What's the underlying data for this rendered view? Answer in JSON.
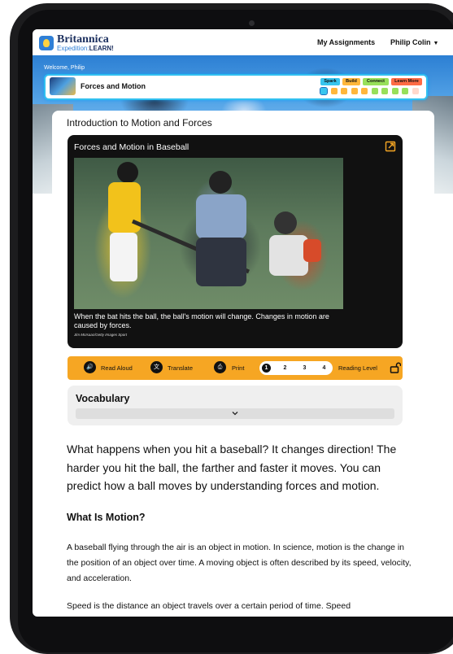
{
  "header": {
    "logo_main": "Britannica",
    "logo_sub_prefix": "Expedition:",
    "logo_sub_brand": "LEARN!",
    "nav_assignments": "My Assignments",
    "user_name": "Philip Colin"
  },
  "lesson": {
    "welcome": "Welcome, Philip",
    "title": "Forces and Motion",
    "phases": [
      "Spark",
      "Build",
      "Connect",
      "Learn More"
    ],
    "progress_colors": [
      "#37c5ee",
      "#ffb73b",
      "#ffb73b",
      "#ffb73b",
      "#ffb73b",
      "#98e05a",
      "#98e05a",
      "#98e05a",
      "#98e05a",
      "#ffd9cc"
    ]
  },
  "page": {
    "title": "Introduction to Motion and Forces"
  },
  "media": {
    "title": "Forces and Motion in Baseball",
    "caption": "When the bat hits the ball, the ball's motion will change. Changes in motion are caused by forces.",
    "credit": "Jim McIsaac/Getty Images Sport"
  },
  "toolbar": {
    "read_aloud": "Read Aloud",
    "translate": "Translate",
    "print": "Print",
    "levels": [
      "1",
      "2",
      "3",
      "4"
    ],
    "active_level": "1",
    "reading_level": "Reading Level"
  },
  "vocab": {
    "title": "Vocabulary"
  },
  "article": {
    "intro": "What happens when you hit a baseball? It changes direction! The harder you hit the ball, the farther and faster it moves. You can predict how a ball moves by understanding forces and motion.",
    "heading": "What Is Motion?",
    "p1": "A baseball flying through the air is an object in motion. In science, motion is the change in the position of an object over time. A moving object is often described by its speed, velocity, and acceleration.",
    "p2": "Speed is the distance an object travels over a certain period of time. Speed"
  },
  "colors": {
    "accent": "#f6a623",
    "lesson_border": "#31c0f0"
  }
}
